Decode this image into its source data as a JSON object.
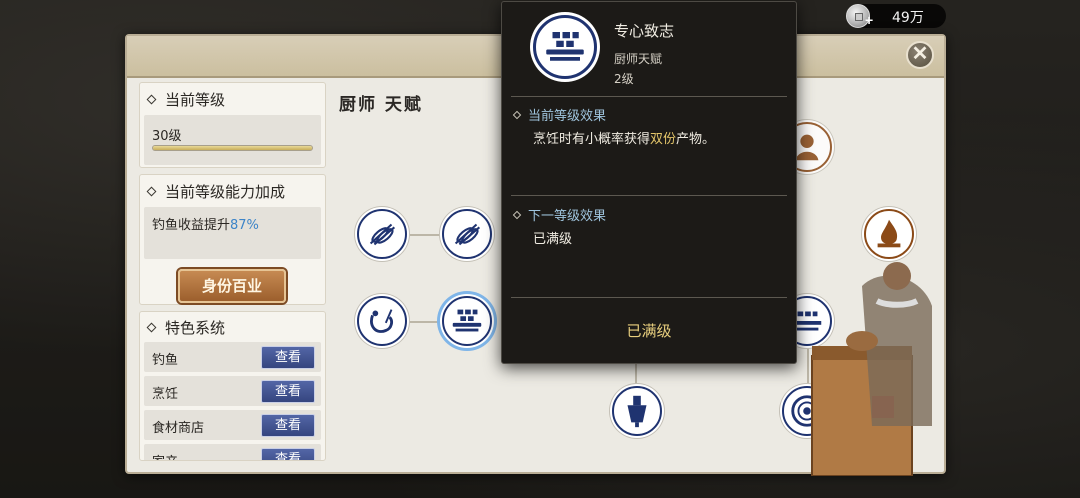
{
  "currency": {
    "amount": "49万",
    "icon": "silver-coin-icon",
    "plus": "+"
  },
  "panel": {
    "tree_title": "厨师 天赋",
    "close_icon": "close-icon"
  },
  "current_level": {
    "title": "当前等级",
    "value": "30级",
    "progress": 1.0
  },
  "ability_bonus": {
    "title": "当前等级能力加成",
    "text": "钓鱼收益提升",
    "value": "87%"
  },
  "identity_button": {
    "label": "身份百业"
  },
  "features": {
    "title": "特色系统",
    "view_label": "查看",
    "items": [
      {
        "label": "钓鱼"
      },
      {
        "label": "烹饪"
      },
      {
        "label": "食材商店"
      },
      {
        "label": "家产"
      }
    ]
  },
  "tooltip": {
    "name": "专心致志",
    "type": "厨师天赋",
    "level": "2级",
    "current_effect_title": "当前等级效果",
    "current_effect_text_a": "烹饪时有小概率获得",
    "current_effect_highlight": "双份",
    "current_effect_text_b": "产物。",
    "next_effect_title": "下一等级效果",
    "next_effect_text": "已满级",
    "status": "已满级"
  },
  "colors": {
    "node_border": "#1f3370",
    "highlight": "#e4c66a",
    "bonus_value": "#3c84c8",
    "view_button": "#35457f"
  }
}
